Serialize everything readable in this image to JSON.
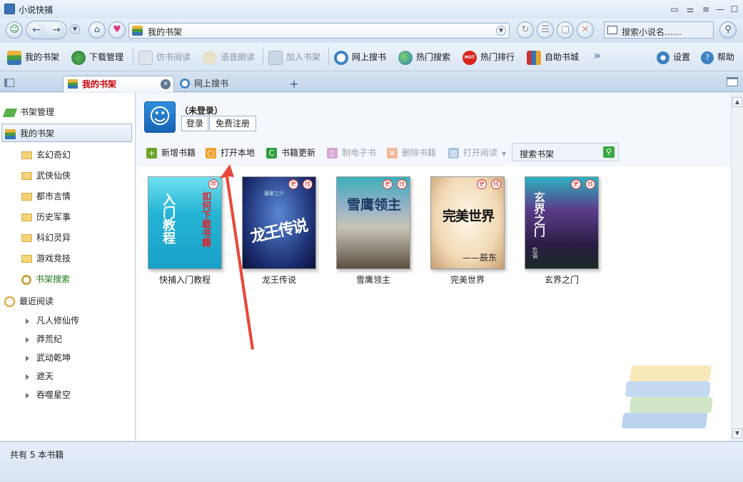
{
  "window": {
    "title": "小说快捕"
  },
  "address": {
    "text": "我的书架"
  },
  "search_top": {
    "placeholder": "搜索小说名……"
  },
  "toolbar": {
    "my_shelf": "我的书架",
    "download_mgr": "下载管理",
    "read": "仿书阅读",
    "voice_read": "语音朗读",
    "add_shelf": "加入书架",
    "web_search": "网上搜书",
    "hot_search": "热门搜索",
    "hot_rank": "热门排行",
    "bookstore": "自助书城",
    "more": "»",
    "settings": "设置",
    "help": "帮助",
    "hot_badge": "HOT"
  },
  "tabs": [
    {
      "label": "我的书架"
    },
    {
      "label": "网上搜书"
    }
  ],
  "sidebar": {
    "shelf_mgr": "书架管理",
    "my_shelf": "我的书架",
    "categories": [
      "玄幻奇幻",
      "武侠仙侠",
      "都市言情",
      "历史军事",
      "科幻灵异",
      "游戏竞技"
    ],
    "shelf_search": "书架搜索",
    "recent": "最近阅读",
    "recent_items": [
      "凡人修仙传",
      "莽荒纪",
      "武动乾坤",
      "遮天",
      "吞噬星空"
    ]
  },
  "user": {
    "status": "（未登录）",
    "login": "登录",
    "register": "免费注册"
  },
  "actions": {
    "add": "新增书籍",
    "open_local": "打开本地",
    "update": "书籍更新",
    "ebook": "制电子书",
    "delete": "删除书籍",
    "open_read": "打开阅读",
    "search": "搜索书架"
  },
  "books": [
    {
      "title": "快捕入门教程",
      "badges": [
        "荐"
      ],
      "cover_left": "入门教程",
      "cover_right": "如何下载书籍"
    },
    {
      "title": "龙王传说",
      "badges": [
        "更",
        "线"
      ],
      "cover_text": "龙王传说",
      "cover_sub": "唐家三少"
    },
    {
      "title": "雪鹰领主",
      "badges": [
        "更",
        "线"
      ],
      "cover_text": "雪鹰领主"
    },
    {
      "title": "完美世界",
      "badges": [
        "更",
        "线"
      ],
      "cover_text": "完美世界",
      "cover_sub": "——辰东"
    },
    {
      "title": "玄界之门",
      "badges": [
        "更",
        "线"
      ],
      "cover_text": "玄界之门",
      "cover_sub": "忘语"
    }
  ],
  "status": {
    "text": "共有 5 本书籍"
  }
}
